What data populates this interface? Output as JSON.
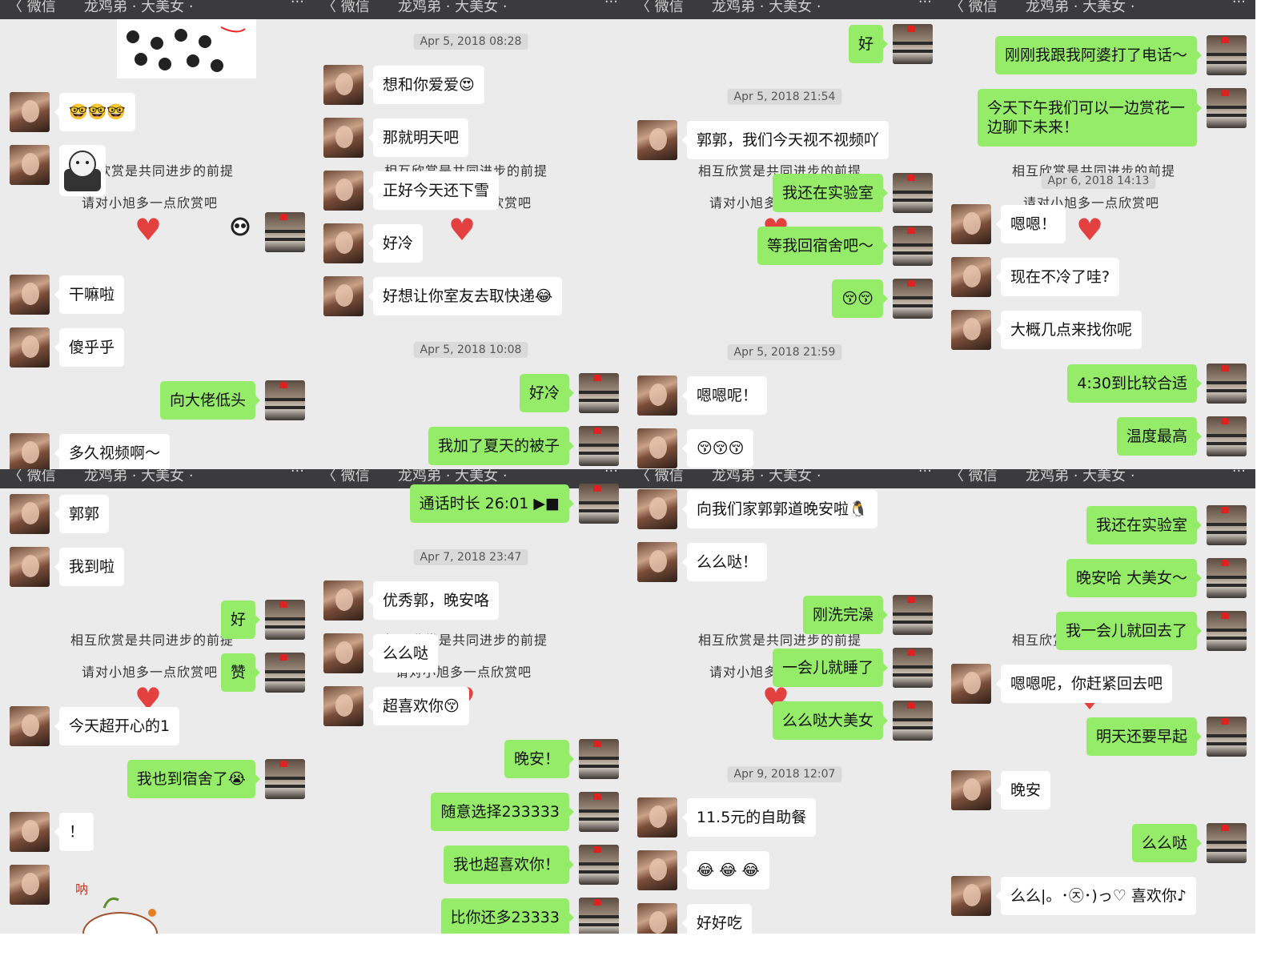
{
  "header": {
    "back_label": "〈 微信",
    "title": "龙鸡弟 · 大美女 ·",
    "more": "···"
  },
  "watermark": {
    "line1": "相互欣赏是共同进步的前提",
    "line2": "请对小旭多一点欣赏吧",
    "heart": "♥"
  },
  "colors": {
    "outgoing_bubble": "#95ec69",
    "incoming_bubble": "#ffffff",
    "chat_background": "#ebebeb",
    "nav_bar": "#3b3b3d"
  },
  "panels": [
    {
      "messages": [
        {
          "side": "in",
          "text": "🤓🤓🤓"
        },
        {
          "side": "in",
          "text": "干嘛啦"
        },
        {
          "side": "in",
          "text": "傻乎乎"
        },
        {
          "side": "out",
          "text": "向大佬低头"
        },
        {
          "side": "in",
          "text": "多久视频啊～"
        }
      ]
    },
    {
      "timestamps": [
        "Apr 5, 2018 08:28",
        "Apr 5, 2018 10:08"
      ],
      "messages": [
        {
          "side": "in",
          "text": "想和你爱爱😍"
        },
        {
          "side": "in",
          "text": "那就明天吧"
        },
        {
          "side": "in",
          "text": "正好今天还下雪"
        },
        {
          "side": "in",
          "text": "好冷"
        },
        {
          "side": "in",
          "text": "好想让你室友去取快递😂"
        },
        {
          "side": "out",
          "text": "好冷"
        },
        {
          "side": "out",
          "text": "我加了夏天的被子"
        }
      ]
    },
    {
      "timestamps": [
        "Apr 5, 2018 21:54",
        "Apr 5, 2018 21:59"
      ],
      "messages": [
        {
          "side": "out",
          "text": "好"
        },
        {
          "side": "in",
          "text": "郭郭，我们今天视不视频吖"
        },
        {
          "side": "out",
          "text": "我还在实验室"
        },
        {
          "side": "out",
          "text": "等我回宿舍吧～"
        },
        {
          "side": "out",
          "text": "😚😚"
        },
        {
          "side": "in",
          "text": "嗯嗯呢！"
        },
        {
          "side": "in",
          "text": "😚😚😚"
        }
      ]
    },
    {
      "timestamps": [
        "Apr 6, 2018 14:13"
      ],
      "messages": [
        {
          "side": "out",
          "text": "刚刚我跟我阿婆打了电话～"
        },
        {
          "side": "out",
          "text": "今天下午我们可以一边赏花一边聊下未来！"
        },
        {
          "side": "in",
          "text": "嗯嗯！"
        },
        {
          "side": "in",
          "text": "现在不冷了哇?"
        },
        {
          "side": "in",
          "text": "大概几点来找你呢"
        },
        {
          "side": "out",
          "text": "4:30到比较合适"
        },
        {
          "side": "out",
          "text": "温度最高"
        }
      ]
    },
    {
      "messages": [
        {
          "side": "in",
          "text": "郭郭"
        },
        {
          "side": "in",
          "text": "我到啦"
        },
        {
          "side": "out",
          "text": "好"
        },
        {
          "side": "out",
          "text": "赞"
        },
        {
          "side": "in",
          "text": "今天超开心的1"
        },
        {
          "side": "out",
          "text": "我也到宿舍了😭"
        },
        {
          "side": "in",
          "text": "！"
        }
      ]
    },
    {
      "timestamps": [
        "Apr 7, 2018 23:47"
      ],
      "messages": [
        {
          "side": "out",
          "text": "通话时长 26:01  ▶■"
        },
        {
          "side": "in",
          "text": "优秀郭，晚安咯"
        },
        {
          "side": "in",
          "text": "么么哒"
        },
        {
          "side": "in",
          "text": "超喜欢你😚"
        },
        {
          "side": "out",
          "text": "晚安！"
        },
        {
          "side": "out",
          "text": "随意选择233333"
        },
        {
          "side": "out",
          "text": "我也超喜欢你！"
        },
        {
          "side": "out",
          "text": "比你还多23333"
        }
      ]
    },
    {
      "timestamps": [
        "Apr 9, 2018 12:07"
      ],
      "messages": [
        {
          "side": "in",
          "text": "向我们家郭郭道晚安啦🐧"
        },
        {
          "side": "in",
          "text": "么么哒！"
        },
        {
          "side": "out",
          "text": "刚洗完澡"
        },
        {
          "side": "out",
          "text": "一会儿就睡了"
        },
        {
          "side": "out",
          "text": "么么哒大美女"
        },
        {
          "side": "in",
          "text": "11.5元的自助餐"
        },
        {
          "side": "in",
          "text": "😂 😂 😂"
        },
        {
          "side": "in",
          "text": "好好吃"
        }
      ]
    },
    {
      "messages": [
        {
          "side": "out",
          "text": "我还在实验室"
        },
        {
          "side": "out",
          "text": "晚安哈 大美女～"
        },
        {
          "side": "out",
          "text": "我一会儿就回去了"
        },
        {
          "side": "in",
          "text": "嗯嗯呢，你赶紧回去吧"
        },
        {
          "side": "out",
          "text": "明天还要早起"
        },
        {
          "side": "in",
          "text": "晚安"
        },
        {
          "side": "out",
          "text": "么么哒"
        },
        {
          "side": "in",
          "text": "么么|。･㉨･)っ♡  喜欢你♪"
        }
      ]
    }
  ]
}
